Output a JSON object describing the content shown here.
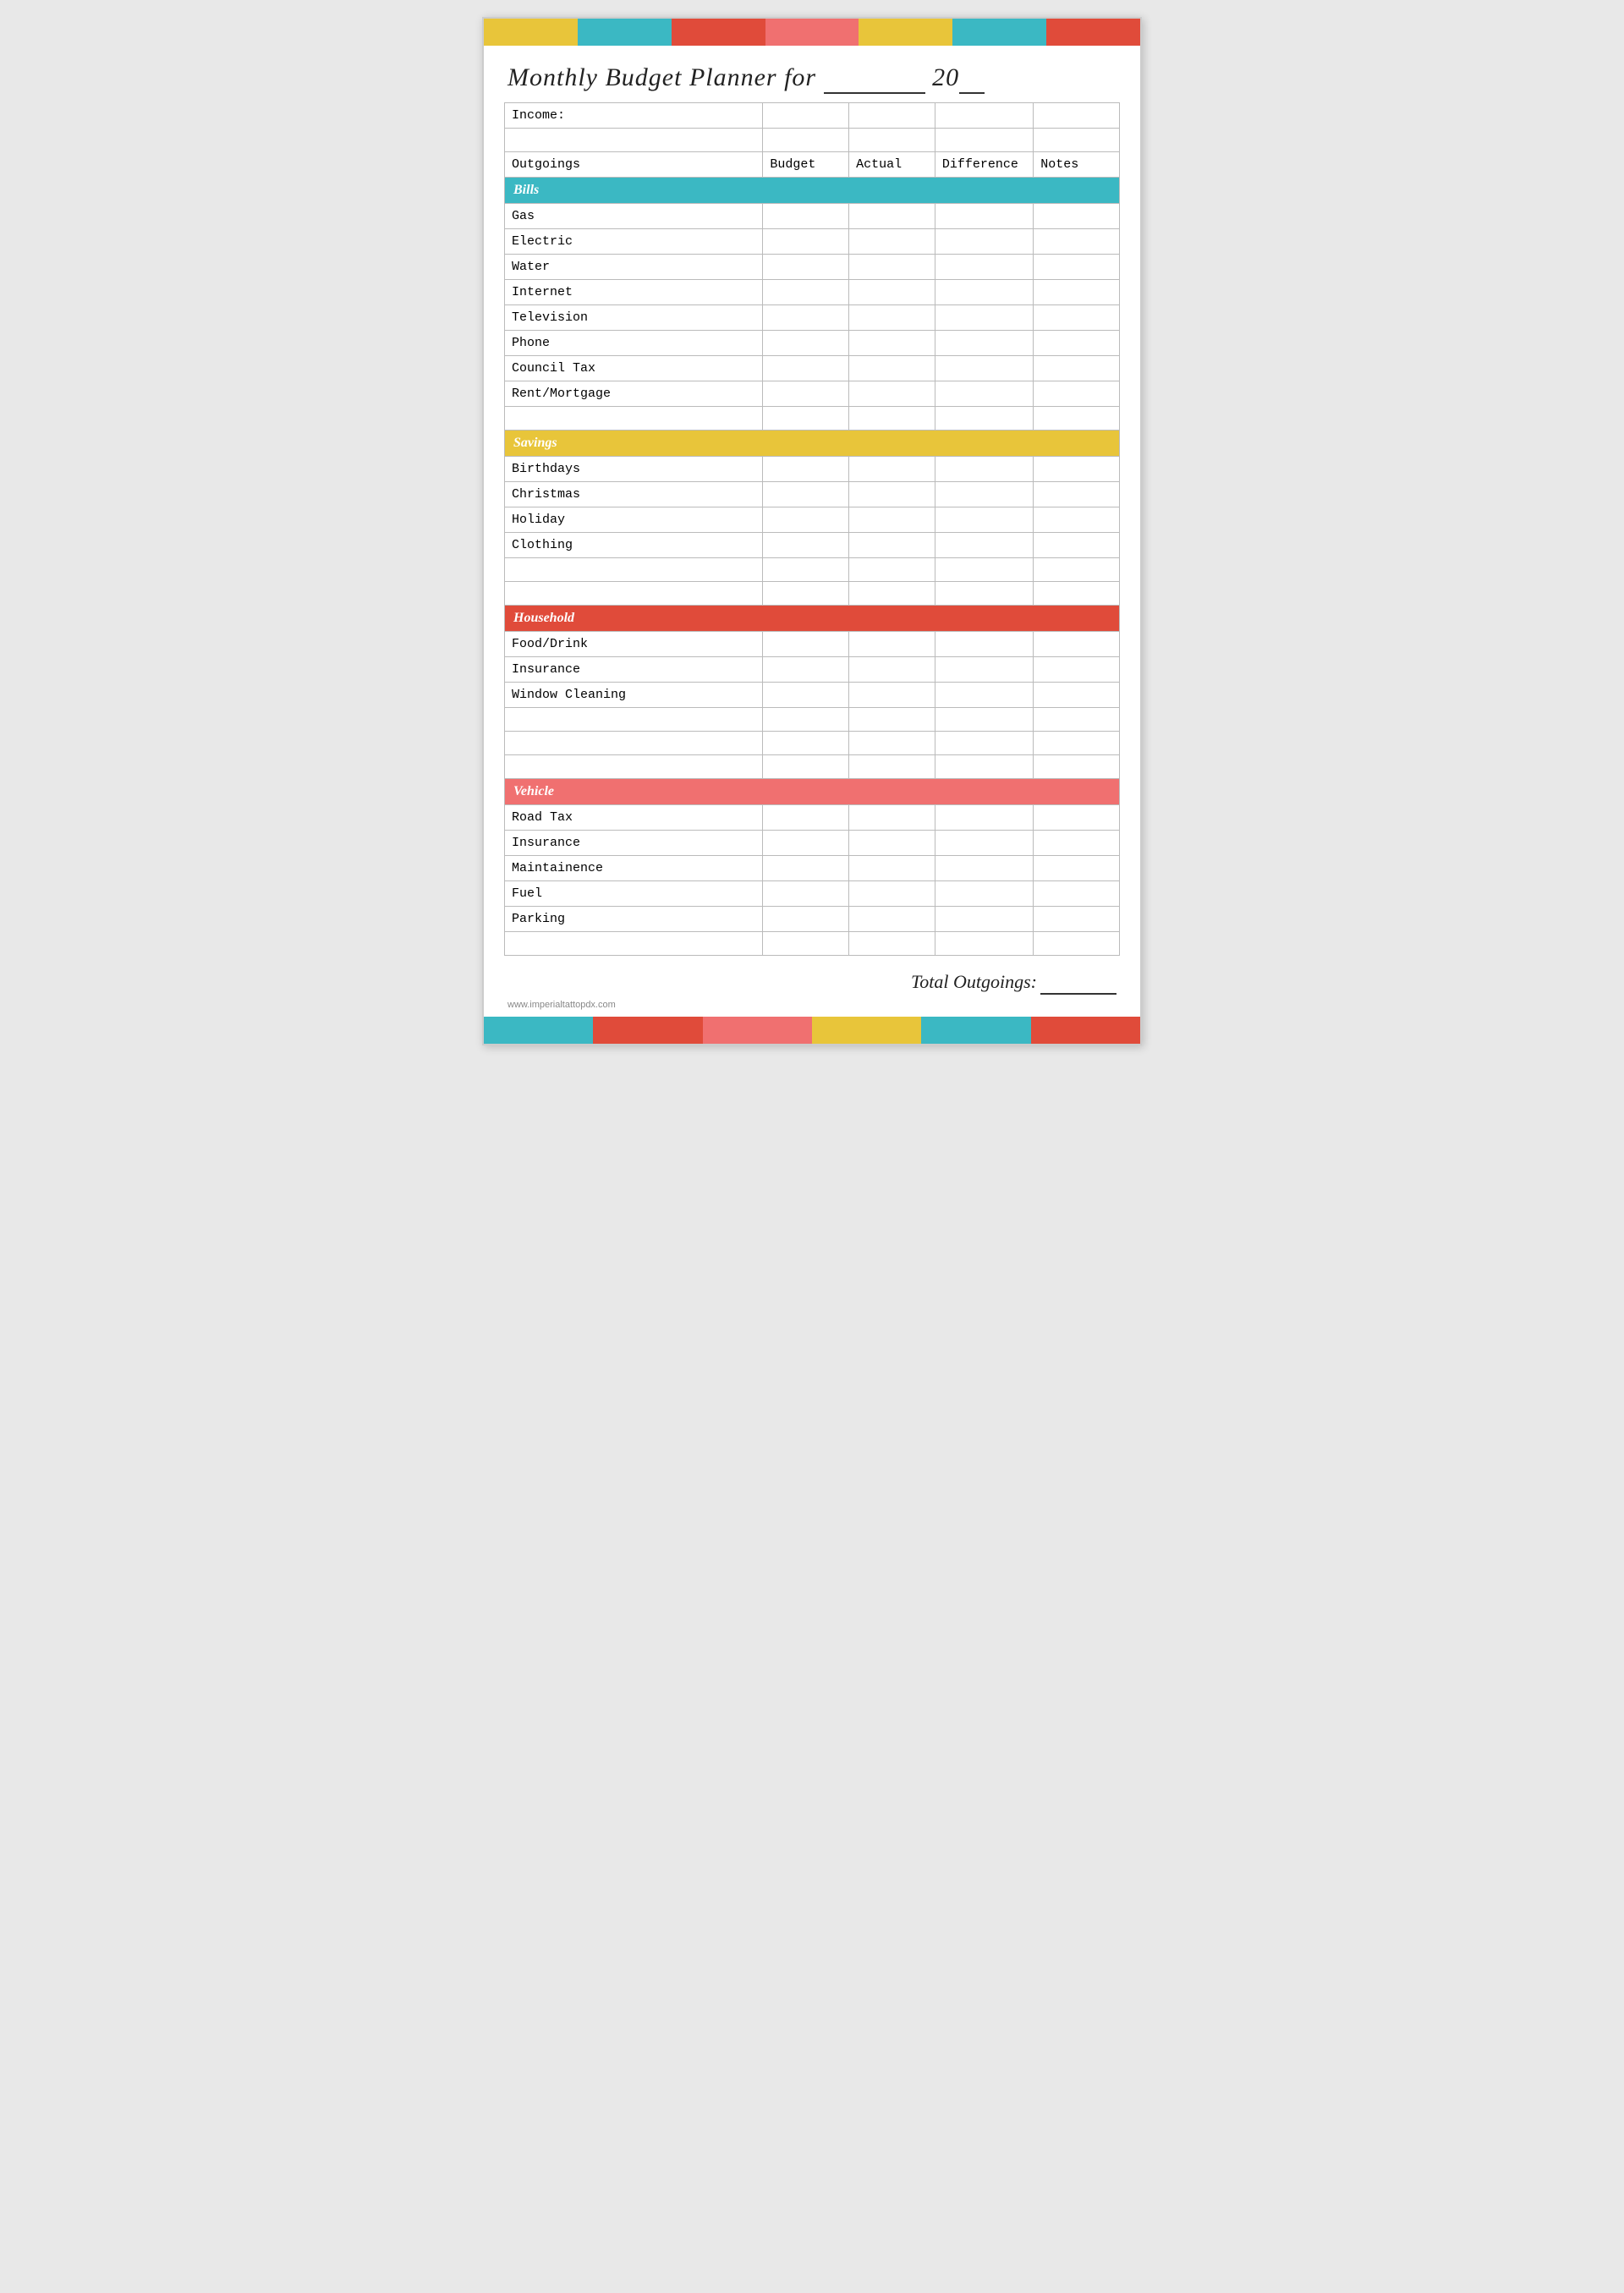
{
  "colors": {
    "yellow": "#e8c53a",
    "teal": "#3bb8c3",
    "red": "#e04b3a",
    "pink": "#f07070",
    "white": "#ffffff"
  },
  "topBar": [
    {
      "color": "#e8c53a"
    },
    {
      "color": "#3bb8c3"
    },
    {
      "color": "#e04b3a"
    },
    {
      "color": "#f07070"
    },
    {
      "color": "#e8c53a"
    },
    {
      "color": "#3bb8c3"
    },
    {
      "color": "#e04b3a"
    }
  ],
  "title": "Monthly Budget Planner for",
  "titleFor": "_________",
  "titleYear": "20__",
  "income_label": "Income:",
  "columns": {
    "outgoings": "Outgoings",
    "budget": "Budget",
    "actual": "Actual",
    "difference": "Difference",
    "notes": "Notes"
  },
  "sections": {
    "bills": {
      "label": "Bills",
      "color": "#3bb8c3",
      "rows": [
        "Gas",
        "Electric",
        "Water",
        "Internet",
        "Television",
        "Phone",
        "Council Tax",
        "Rent/Mortgage",
        "",
        ""
      ]
    },
    "savings": {
      "label": "Savings",
      "color": "#e8c53a",
      "rows": [
        "Birthdays",
        "Christmas",
        "Holiday",
        "Clothing",
        "",
        ""
      ]
    },
    "household": {
      "label": "Household",
      "color": "#e04b3a",
      "rows": [
        "Food/Drink",
        "Insurance",
        "Window Cleaning",
        "",
        "",
        ""
      ]
    },
    "vehicle": {
      "label": "Vehicle",
      "color": "#f07070",
      "rows": [
        "Road Tax",
        "Insurance",
        "Maintainence",
        "Fuel",
        "Parking",
        ""
      ]
    }
  },
  "total_label": "Total Outgoings:",
  "total_value": "_______",
  "watermark": "www.imperialtattopdx.com",
  "bottomBar": [
    {
      "color": "#3bb8c3"
    },
    {
      "color": "#e04b3a"
    },
    {
      "color": "#f07070"
    },
    {
      "color": "#e8c53a"
    },
    {
      "color": "#3bb8c3"
    },
    {
      "color": "#e04b3a"
    }
  ]
}
